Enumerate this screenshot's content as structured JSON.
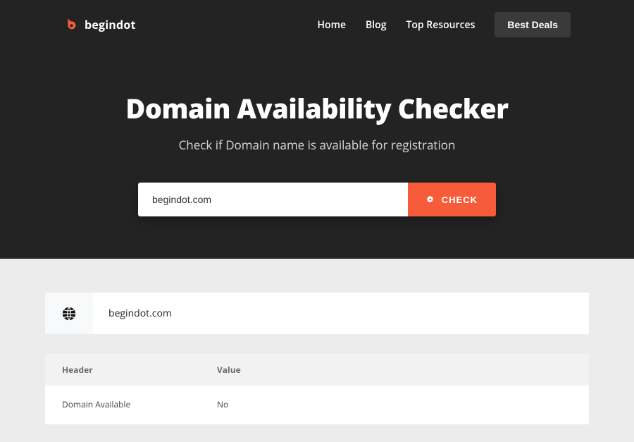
{
  "brand": {
    "name": "begindot"
  },
  "nav": {
    "links": [
      {
        "label": "Home"
      },
      {
        "label": "Blog"
      },
      {
        "label": "Top Resources"
      }
    ],
    "deals_label": "Best Deals"
  },
  "hero": {
    "title": "Domain Availability Checker",
    "subtitle": "Check if Domain name is available for registration"
  },
  "search": {
    "value": "begindot.com",
    "button_label": "CHECK"
  },
  "result": {
    "domain": "begindot.com",
    "table": {
      "headers": {
        "col1": "Header",
        "col2": "Value"
      },
      "rows": [
        {
          "header": "Domain Available",
          "value": "No"
        }
      ]
    }
  }
}
